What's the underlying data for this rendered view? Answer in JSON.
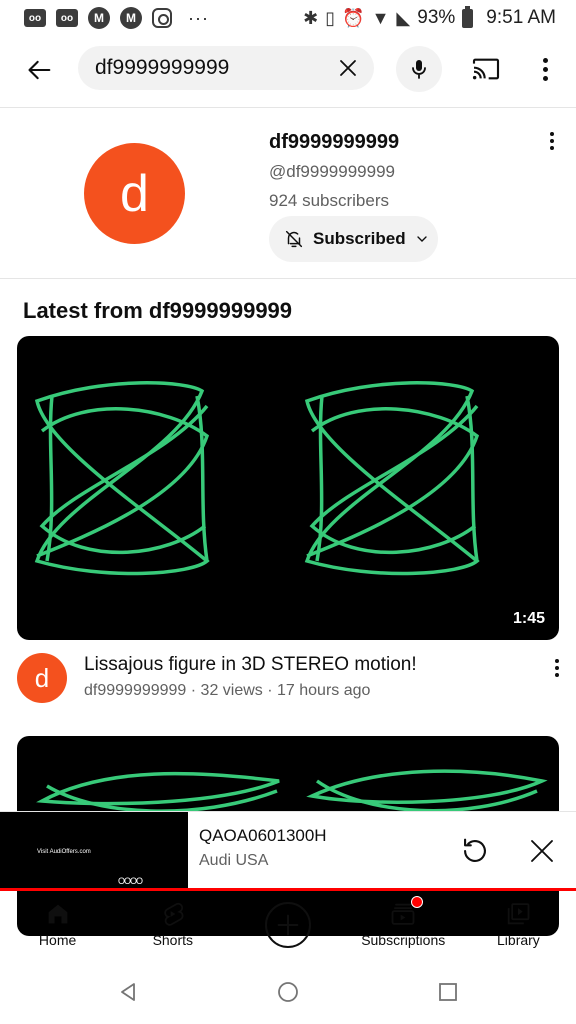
{
  "status_bar": {
    "battery": "93%",
    "time": "9:51 AM",
    "left_icons": [
      "voicemail-icon",
      "voicemail-icon",
      "gmail-icon",
      "gmail-icon",
      "instagram-icon"
    ],
    "more": "···"
  },
  "search": {
    "query": "df9999999999"
  },
  "channel": {
    "avatar_letter": "d",
    "name": "df9999999999",
    "handle": "@df9999999999",
    "subscribers": "924 subscribers",
    "subscribe_label": "Subscribed"
  },
  "section": {
    "title": "Latest from df9999999999"
  },
  "videos": [
    {
      "duration": "1:45",
      "title": "Lissajous figure in 3D STEREO motion!",
      "meta": "df9999999999 · 32 views · 17 hours ago",
      "avatar_letter": "d"
    }
  ],
  "mini_player": {
    "title": "QAOA0601300H",
    "channel": "Audi USA",
    "thumb_text": "Visit AudiOffers.com",
    "thumb_logo": "OOOO",
    "progress": 1.0
  },
  "bottom_nav": [
    {
      "label": "Home",
      "icon": "home-icon"
    },
    {
      "label": "Shorts",
      "icon": "shorts-icon"
    },
    {
      "label": "",
      "icon": "create-icon"
    },
    {
      "label": "Subscriptions",
      "icon": "subscriptions-icon"
    },
    {
      "label": "Library",
      "icon": "library-icon"
    }
  ],
  "colors": {
    "accent_red": "#ff0000",
    "avatar_orange": "#f4511e",
    "lissajous_green": "#3ddc84"
  }
}
